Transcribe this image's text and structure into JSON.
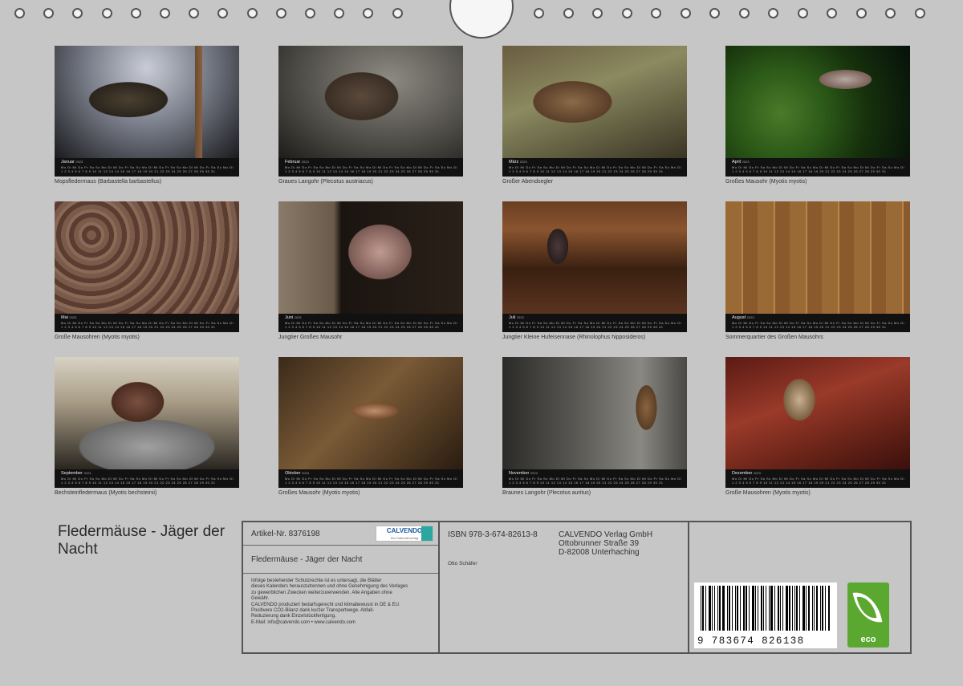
{
  "months": [
    {
      "name": "Januar",
      "year": "2023",
      "caption": "Mopsfledermaus (Barbastella barbastellus)"
    },
    {
      "name": "Februar",
      "year": "2023",
      "caption": "Graues Langohr (Plecotus austriacus)"
    },
    {
      "name": "März",
      "year": "2023",
      "caption": "Großer Abendsegler"
    },
    {
      "name": "April",
      "year": "2023",
      "caption": "Großes Mausohr (Myotis myotis)"
    },
    {
      "name": "Mai",
      "year": "2023",
      "caption": "Große Mausohren (Myotis myotis)"
    },
    {
      "name": "Juni",
      "year": "2023",
      "caption": "Jungtier Großes Mausohr"
    },
    {
      "name": "Juli",
      "year": "2023",
      "caption": "Jungtier Kleine Hufeisennase (Rhinolophus hipposideros)"
    },
    {
      "name": "August",
      "year": "2023",
      "caption": "Sommerquartier des Großen Mausohrs"
    },
    {
      "name": "September",
      "year": "2023",
      "caption": "Bechsteinfledermaus (Myotis bechsteinii)"
    },
    {
      "name": "Oktober",
      "year": "2023",
      "caption": "Großes Mausohr (Myotis myotis)"
    },
    {
      "name": "November",
      "year": "2023",
      "caption": "Braunes Langohr (Plecotus auritus)"
    },
    {
      "name": "Dezember",
      "year": "2023",
      "caption": "Große Mausohren (Myotis myotis)"
    }
  ],
  "book": {
    "title": "Fledermäuse - Jäger der Nacht"
  },
  "info": {
    "artikel": "Artikel-Nr. 8376198",
    "logo_text": "CALVENDO",
    "logo_sub": "Der Kalenderverlag",
    "subtitle": "Fledermäuse - Jäger der Nacht",
    "legal": [
      "Infolge bestehender Schutzrechte ist es untersagt, die Blätter",
      "dieses Kalenders herauszutrennen und ohne Genehmigung des Verlages",
      "zu gewerblichen Zwecken weiterzuverwenden. Alle Angaben ohne",
      "Gewähr.",
      "CALVENDO produziert bedarfsgerecht und klimabewusst in DE & EU.",
      "Positivere CO2-Bilanz dank kurzer Transportwege. Abfall-",
      "Reduzierung dank Einzelstückfertigung.",
      "E-Mail: info@calvendo.com • www.calvendo.com"
    ],
    "isbn": "ISBN 978-3-674-82613-8",
    "author": "Otto Schäfer",
    "publisher": [
      "CALVENDO Verlag GmbH",
      "Ottobrunner Straße 39",
      "D-82008 Unterhaching"
    ],
    "barcode_number": "9 783674 826138",
    "eco_label": "eco"
  }
}
